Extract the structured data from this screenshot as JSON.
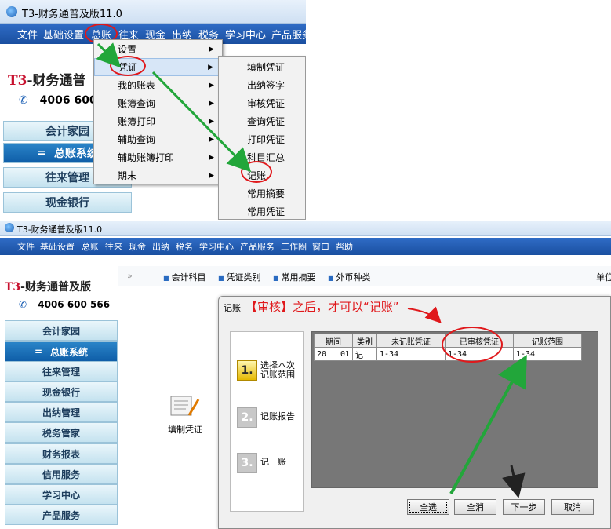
{
  "top": {
    "title": "T3-财务通普及版11.0",
    "menu": [
      "文件",
      "基础设置",
      "总账",
      "往来",
      "现金",
      "出纳",
      "税务",
      "学习中心",
      "产品服务"
    ],
    "logo": "T3-财务通普及版",
    "logo_visible": "T3-财务通普",
    "phone": "4006 600",
    "sidebar": [
      "会计家园",
      "总账系统",
      "往来管理",
      "现金银行"
    ],
    "menu1": [
      "设置",
      "凭证",
      "我的账表",
      "账簿查询",
      "账簿打印",
      "辅助查询",
      "辅助账簿打印",
      "期末"
    ],
    "menu2": [
      "填制凭证",
      "出纳签字",
      "审核凭证",
      "查询凭证",
      "打印凭证",
      "科目汇总",
      "记账",
      "常用摘要",
      "常用凭证"
    ]
  },
  "bottom": {
    "title": "T3-财务通普及版11.0",
    "menu": [
      "文件",
      "基础设置",
      "总账",
      "往来",
      "现金",
      "出纳",
      "税务",
      "学习中心",
      "产品服务",
      "工作圈",
      "窗口",
      "帮助"
    ],
    "logo": "T3-财务通普及版",
    "phone": "4006 600 566",
    "sidebar": [
      "会计家园",
      "总账系统",
      "往来管理",
      "现金银行",
      "出纳管理",
      "税务管家",
      "财务报表",
      "信用服务",
      "学习中心",
      "产品服务"
    ],
    "toolbar_arrow": "»",
    "toolbar": [
      "会计科目",
      "凭证类别",
      "常用摘要",
      "外币种类"
    ],
    "toolbar_right": "单位",
    "desktop_icon_label": "填制凭证",
    "dialog": {
      "title": "记账",
      "annotation": "【审核】之后，才可以“记账”",
      "steps": [
        {
          "num": "1.",
          "label": "选择本次记账范围"
        },
        {
          "num": "2.",
          "label": "记账报告"
        },
        {
          "num": "3.",
          "label": "记　账"
        }
      ],
      "columns": [
        "期间",
        "类别",
        "未记账凭证",
        "已审核凭证",
        "记账范围"
      ],
      "rows": [
        {
          "period": "20",
          "month": "01",
          "type": "记",
          "unposted": "1-34",
          "audited": "1-34",
          "range": "1-34"
        }
      ],
      "buttons": [
        "全选",
        "全消",
        "下一步",
        "取消"
      ]
    }
  },
  "colors": {
    "accent_red": "#e0181b",
    "arrow_green": "#22a63a",
    "menubar_blue": "#2f6cc6"
  }
}
